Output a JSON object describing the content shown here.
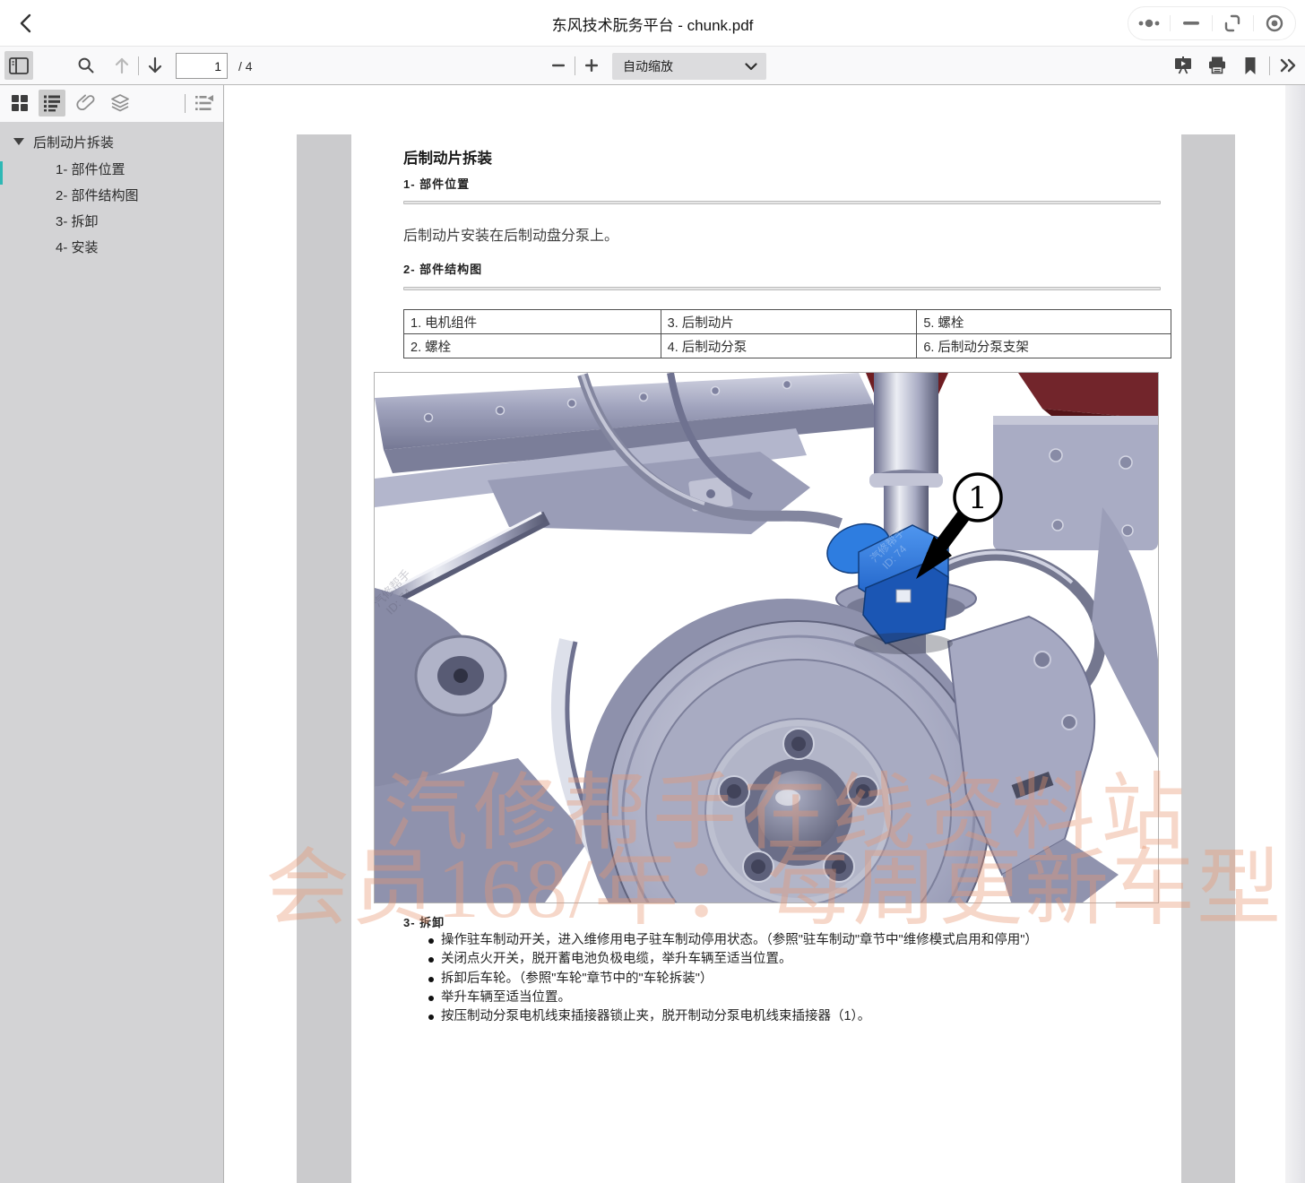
{
  "window": {
    "title": "东风技术朊务平台 - chunk.pdf"
  },
  "titlebar_icons": [
    "back-chevron-icon",
    "more-dots-icon",
    "minimize-icon",
    "restore-window-icon",
    "record-target-icon"
  ],
  "toolbar": {
    "page_value": "1",
    "page_total": "/ 4",
    "zoom_label": "自动缩放",
    "icons": [
      "sidebar-toggle-icon",
      "search-icon",
      "arrow-up-icon",
      "arrow-down-icon",
      "zoom-out-icon",
      "zoom-in-icon",
      "presentation-mode-icon",
      "print-icon",
      "bookmark-icon",
      "more-tools-icon"
    ]
  },
  "sidebar": {
    "icons": [
      "thumbnails-icon",
      "outline-icon",
      "attachments-icon",
      "layers-icon",
      "current-outline-item-icon"
    ],
    "outline": {
      "root": "后制动片拆装",
      "items": [
        "1- 部件位置",
        "2- 部件结构图",
        "3- 拆卸",
        "4- 安装"
      ]
    }
  },
  "doc": {
    "title": "后制动片拆装",
    "s1": {
      "heading": "1- 部件位置",
      "body": "后制动片安装在后制动盘分泵上。"
    },
    "s2": {
      "heading": "2- 部件结构图"
    },
    "table": {
      "rows": [
        [
          "1. 电机组件",
          "3. 后制动片",
          "5. 螺栓"
        ],
        [
          "2. 螺栓",
          "4. 后制动分泵",
          "6. 后制动分泵支架"
        ]
      ]
    },
    "figure": {
      "callout": "1",
      "stamp_name": "汽修帮手",
      "stamp_id": "ID: 74"
    },
    "s3": {
      "heading": "3- 拆卸",
      "bullets": [
        "操作驻车制动开关，进入维修用电子驻车制动停用状态。（参照\"驻车制动\"章节中\"维修模式启用和停用\"）",
        "关闭点火开关，脱开蓄电池负极电缆，举升车辆至适当位置。",
        "拆卸后车轮。（参照\"车轮\"章节中的\"车轮拆装\"）",
        "举升车辆至适当位置。",
        "按压制动分泵电机线束插接器锁止夹，脱开制动分泵电机线束插接器（1）。"
      ]
    }
  },
  "watermark": {
    "line1": "汽修帮手在线资料站",
    "line2": "会员168/年：每周更新车型",
    "color": "#e79670"
  }
}
